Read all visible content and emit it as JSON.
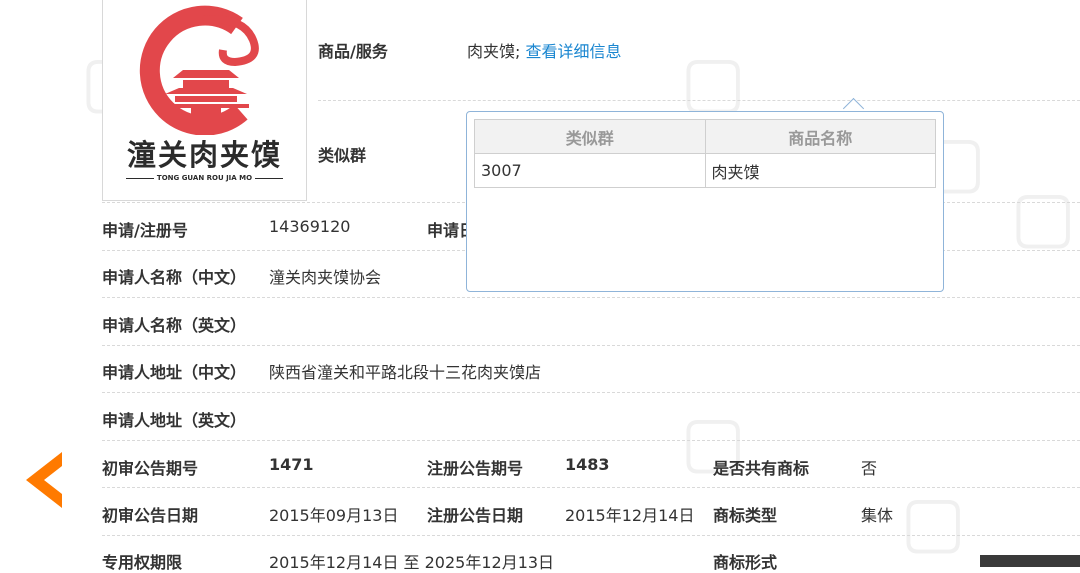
{
  "logo": {
    "title": "潼关肉夹馍",
    "subtitle": "TONG GUAN ROU JIA MO",
    "accent_color": "#e2474b"
  },
  "goods": {
    "label": "商品/服务",
    "value": "肉夹馍;",
    "link": "查看详细信息"
  },
  "similar_group_label": "类似群",
  "popup": {
    "headers": [
      "类似群",
      "商品名称"
    ],
    "rows": [
      [
        "3007",
        "肉夹馍"
      ]
    ]
  },
  "fields": {
    "reg_no_label": "申请/注册号",
    "reg_no": "14369120",
    "apply_date_label": "申请日",
    "applicant_cn_label": "申请人名称（中文）",
    "applicant_cn": "潼关肉夹馍协会",
    "applicant_en_label": "申请人名称（英文）",
    "address_cn_label": "申请人地址（中文）",
    "address_cn": "陕西省潼关和平路北段十三花肉夹馍店",
    "address_en_label": "申请人地址（英文）",
    "prelim_no_label": "初审公告期号",
    "prelim_no": "1471",
    "reg_notice_no_label": "注册公告期号",
    "reg_notice_no": "1483",
    "shared_label": "是否共有商标",
    "shared": "否",
    "prelim_date_label": "初审公告日期",
    "prelim_date": "2015年09月13日",
    "reg_notice_date_label": "注册公告日期",
    "reg_notice_date": "2015年12月14日",
    "type_label": "商标类型",
    "type": "集体",
    "term_label": "专用权期限",
    "term": "2015年12月14日 至 2025年12月13日",
    "form_label": "商标形式"
  },
  "colors": {
    "link": "#1a86d0",
    "nav_arrow": "#ff7a00",
    "popup_border": "#8fb4d9"
  },
  "icons": {
    "nav_prev": "chevron-left-icon"
  }
}
